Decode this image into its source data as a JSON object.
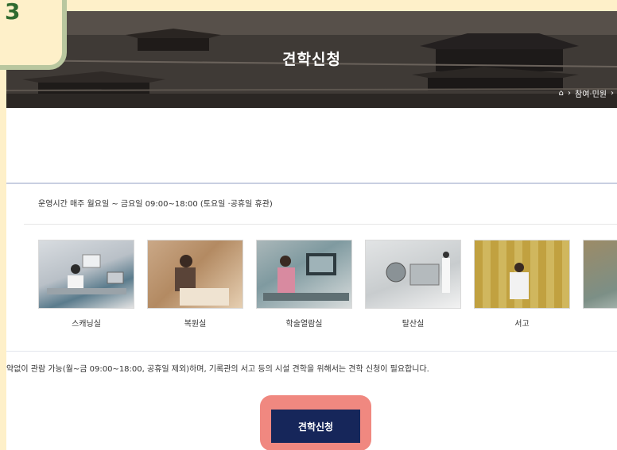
{
  "step_badge": {
    "number": "3"
  },
  "hero": {
    "title": "견학신청",
    "breadcrumb": {
      "current": "참여·민원"
    }
  },
  "info": {
    "hours": "운영시간 매주 월요일 ~ 금요일 09:00~18:00 (토요일 ·공휴일 휴관)",
    "rooms": [
      {
        "label": "스캐닝실"
      },
      {
        "label": "복원실"
      },
      {
        "label": "학술열람실"
      },
      {
        "label": "탈산실"
      },
      {
        "label": "서고"
      },
      {
        "label": ""
      }
    ]
  },
  "notice": "약없이 관람 가능(월~금 09:00~18:00, 공휴일 제외)하며, 기록관의 서고 등의 시설 견학을 위해서는 견학 신청이 필요합니다.",
  "apply_button": {
    "label": "견학신청"
  }
}
